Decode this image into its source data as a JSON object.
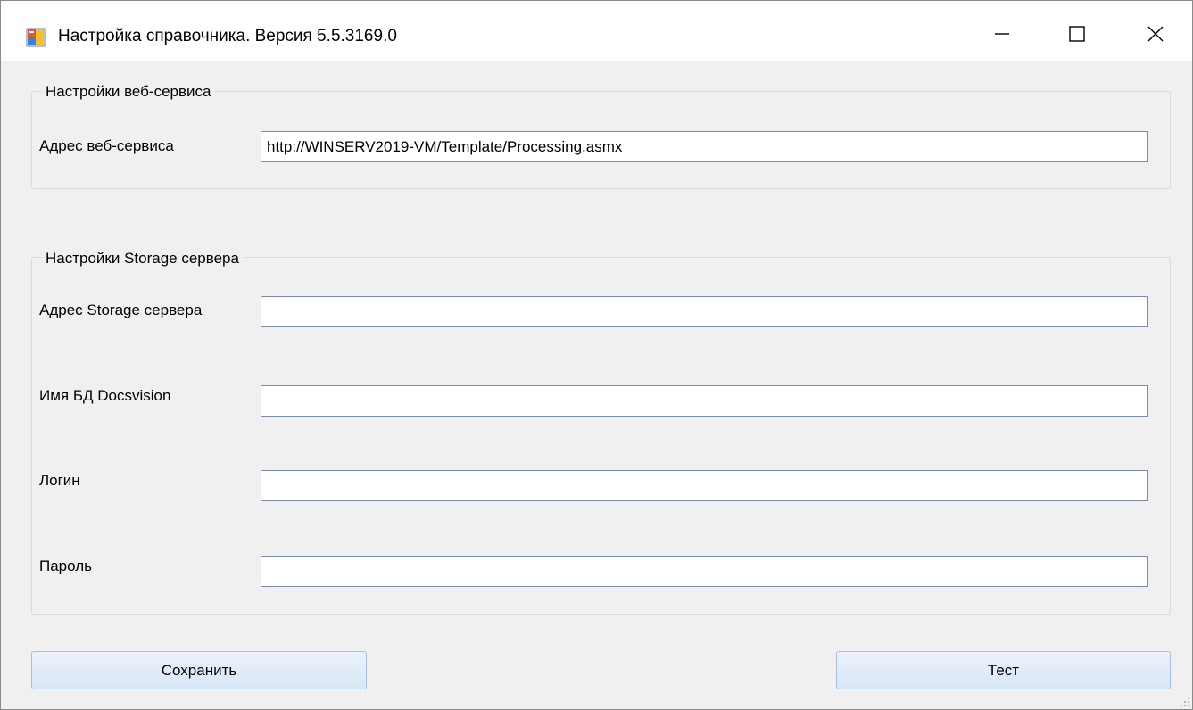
{
  "window": {
    "title": "Настройка справочника. Версия  5.5.3169.0",
    "icon": "app-form-icon",
    "controls": {
      "minimize_icon": "minimize-icon",
      "maximize_icon": "maximize-icon",
      "close_icon": "close-icon"
    }
  },
  "webservice_group": {
    "legend": "Настройки веб-сервиса",
    "address_label": "Адрес веб-сервиса",
    "address_value": "http://WINSERV2019-VM/Template/Processing.asmx"
  },
  "storage_group": {
    "legend": "Настройки Storage сервера",
    "server_label": "Адрес Storage сервера",
    "server_value": "",
    "db_label": "Имя БД Docsvision",
    "db_value": "",
    "login_label": "Логин",
    "login_value": "",
    "password_label": "Пароль",
    "password_value": ""
  },
  "buttons": {
    "save_label": "Сохранить",
    "test_label": "Тест"
  },
  "colors": {
    "window_bg": "#f0f0f0",
    "titlebar_bg": "#ffffff",
    "input_border": "#7a8ba6",
    "button_border": "#a8bedc"
  }
}
